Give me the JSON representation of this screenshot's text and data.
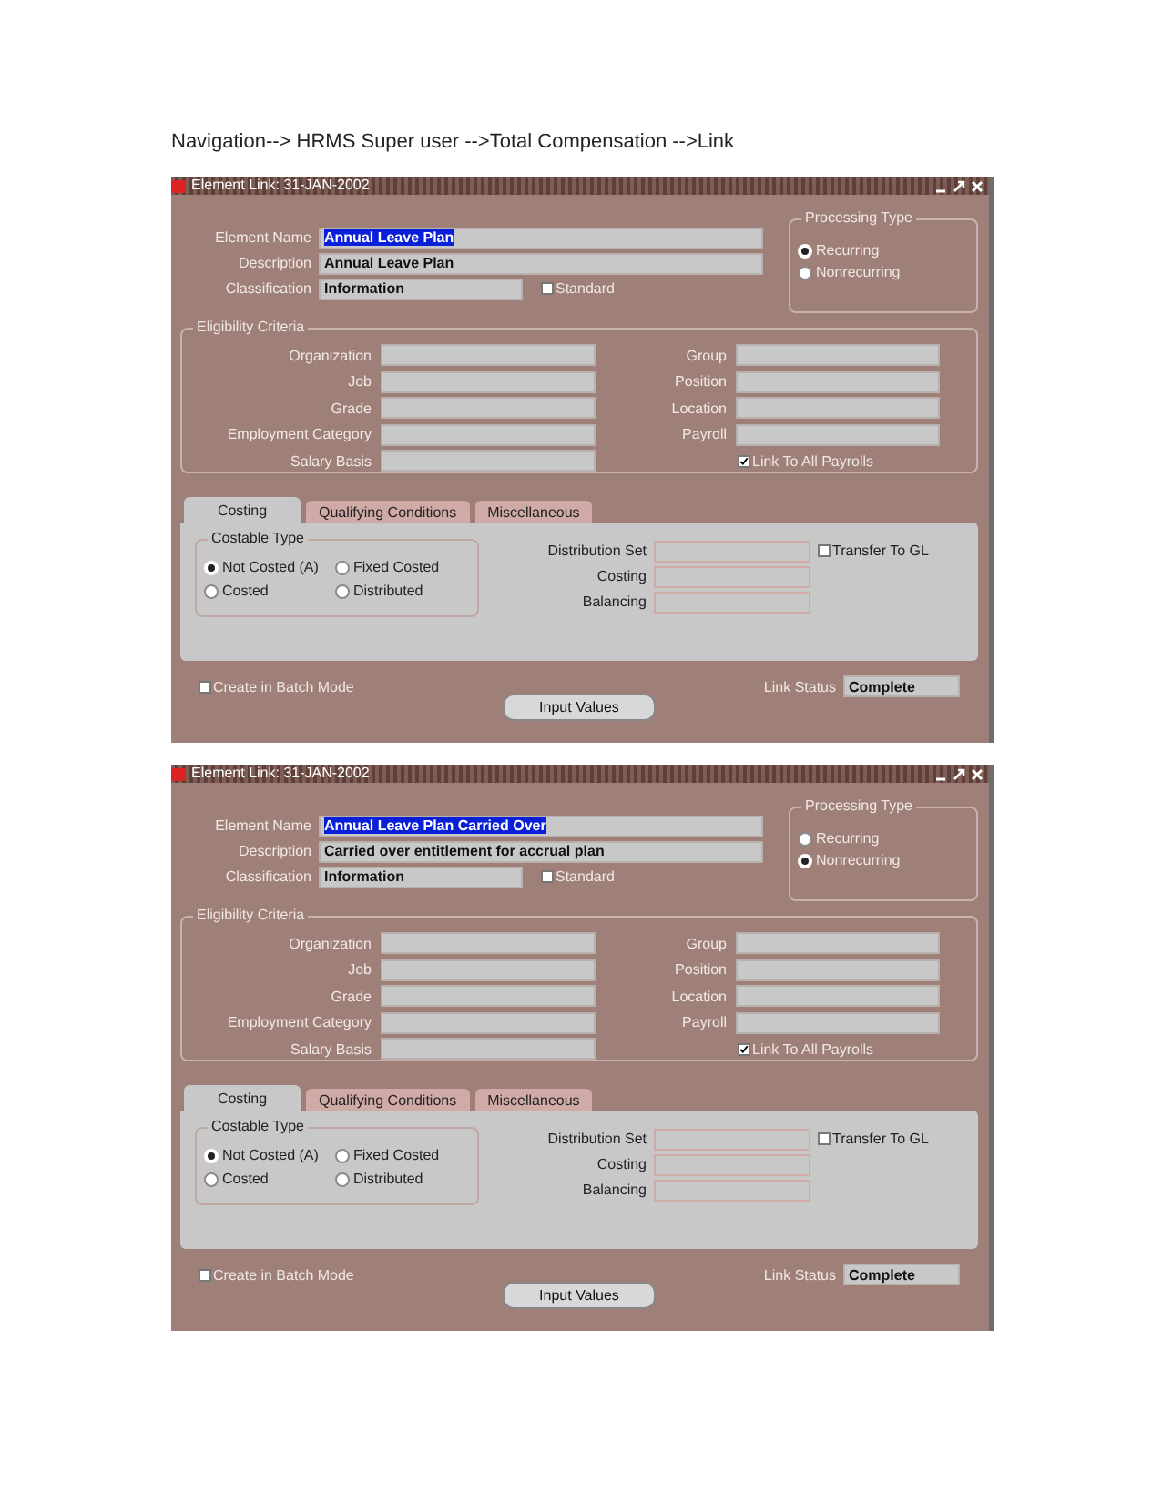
{
  "heading": "Navigation--> HRMS Super user -->Total Compensation -->Link",
  "windows": [
    {
      "title": "Element Link: 31-JAN-2002",
      "fields": [
        {
          "label": "Element Name",
          "value": "Annual Leave Plan",
          "highlighted": true
        },
        {
          "label": "Description",
          "value": "Annual Leave Plan",
          "highlighted": false
        },
        {
          "label": "Classification",
          "value": "Information",
          "highlighted": false
        }
      ],
      "standard": {
        "label": "Standard",
        "checked": false
      },
      "processing_type": {
        "title": "Processing Type",
        "options": [
          {
            "label": "Recurring",
            "selected": true
          },
          {
            "label": "Nonrecurring",
            "selected": false
          }
        ]
      },
      "eligibility": {
        "title": "Eligibility Criteria",
        "left": [
          "Organization",
          "Job",
          "Grade",
          "Employment Category",
          "Salary Basis"
        ],
        "right": [
          "Group",
          "Position",
          "Location",
          "Payroll"
        ],
        "link_all": {
          "label": "Link To All Payrolls",
          "checked": true
        }
      },
      "tabs": [
        {
          "label": "Costing",
          "selected": true
        },
        {
          "label": "Qualifying Conditions",
          "selected": false
        },
        {
          "label": "Miscellaneous",
          "selected": false
        }
      ],
      "costable_type": {
        "title": "Costable Type",
        "options": [
          {
            "label": "Not Costed (A)",
            "selected": true
          },
          {
            "label": "Fixed Costed",
            "selected": false
          },
          {
            "label": "Costed",
            "selected": false
          },
          {
            "label": "Distributed",
            "selected": false
          }
        ]
      },
      "costing_fields": [
        "Distribution Set",
        "Costing",
        "Balancing"
      ],
      "transfer_gl": {
        "label": "Transfer To GL",
        "checked": false
      },
      "batch_mode": {
        "label": "Create in Batch Mode",
        "checked": false
      },
      "link_status": {
        "label": "Link Status",
        "value": "Complete"
      },
      "button": "Input Values"
    },
    {
      "title": "Element Link: 31-JAN-2002",
      "fields": [
        {
          "label": "Element Name",
          "value": "Annual Leave Plan Carried Over",
          "highlighted": true
        },
        {
          "label": "Description",
          "value": "Carried over entitlement for accrual plan",
          "highlighted": false
        },
        {
          "label": "Classification",
          "value": "Information",
          "highlighted": false
        }
      ],
      "standard": {
        "label": "Standard",
        "checked": false
      },
      "processing_type": {
        "title": "Processing Type",
        "options": [
          {
            "label": "Recurring",
            "selected": false
          },
          {
            "label": "Nonrecurring",
            "selected": true
          }
        ]
      },
      "eligibility": {
        "title": "Eligibility Criteria",
        "left": [
          "Organization",
          "Job",
          "Grade",
          "Employment Category",
          "Salary Basis"
        ],
        "right": [
          "Group",
          "Position",
          "Location",
          "Payroll"
        ],
        "link_all": {
          "label": "Link To All Payrolls",
          "checked": true
        }
      },
      "tabs": [
        {
          "label": "Costing",
          "selected": true
        },
        {
          "label": "Qualifying Conditions",
          "selected": false
        },
        {
          "label": "Miscellaneous",
          "selected": false
        }
      ],
      "costable_type": {
        "title": "Costable Type",
        "options": [
          {
            "label": "Not Costed (A)",
            "selected": true
          },
          {
            "label": "Fixed Costed",
            "selected": false
          },
          {
            "label": "Costed",
            "selected": false
          },
          {
            "label": "Distributed",
            "selected": false
          }
        ]
      },
      "costing_fields": [
        "Distribution Set",
        "Costing",
        "Balancing"
      ],
      "transfer_gl": {
        "label": "Transfer To GL",
        "checked": false
      },
      "batch_mode": {
        "label": "Create in Batch Mode",
        "checked": false
      },
      "link_status": {
        "label": "Link Status",
        "value": "Complete"
      },
      "button": "Input Values"
    }
  ]
}
